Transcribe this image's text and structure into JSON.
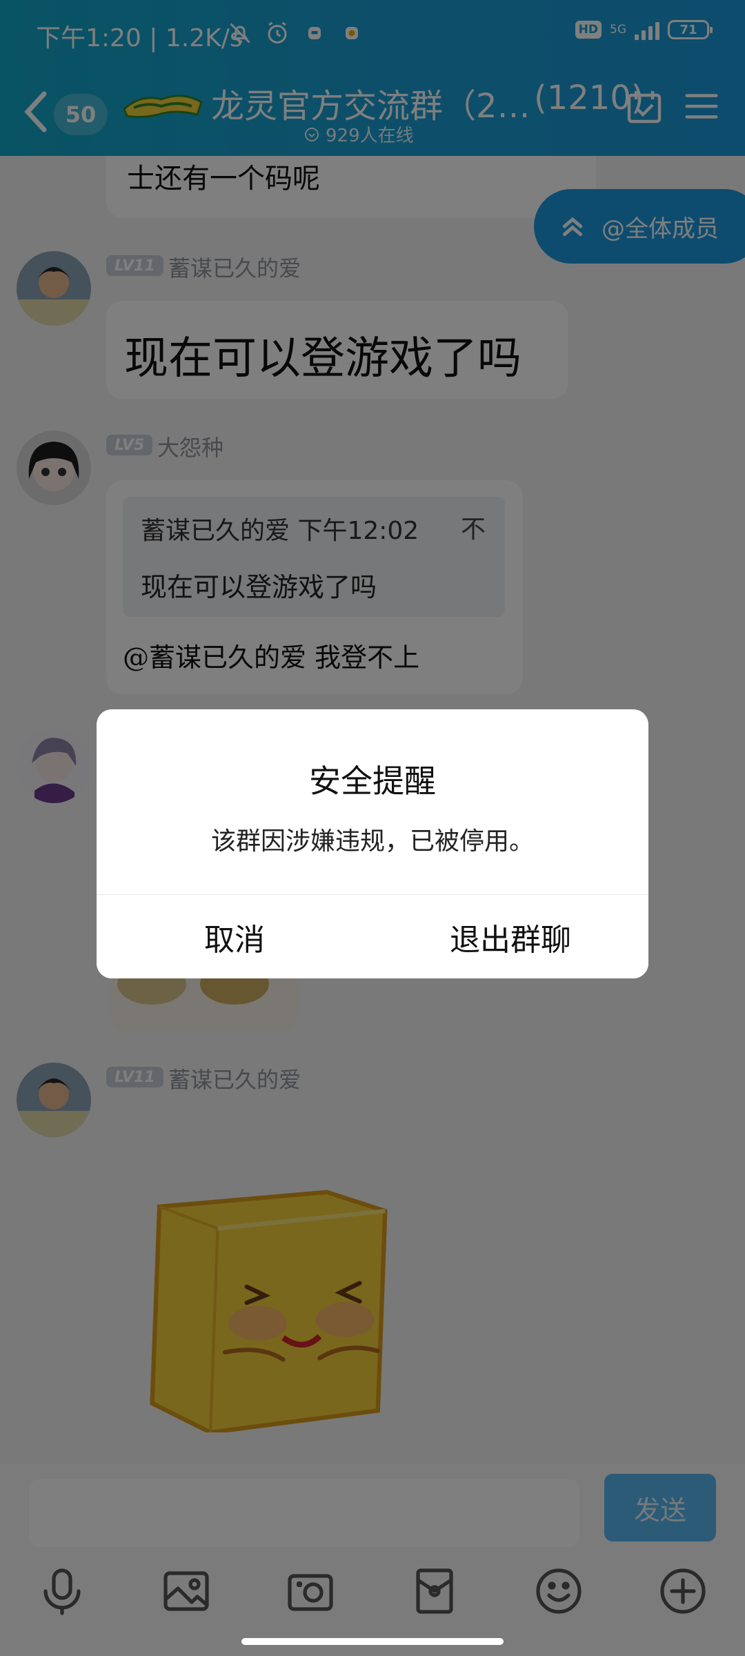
{
  "status_bar": {
    "time": "下午1:20 | 1.2K/s",
    "hd": "HD",
    "network": "5G",
    "battery": "71"
  },
  "header": {
    "unread_count": "50",
    "group_name": "龙灵官方交流群（2…",
    "member_count": "(1210)",
    "online_text": "929人在线"
  },
  "at_all_label": "@全体成员",
  "messages": [
    {
      "text": "士还有一个码呢"
    },
    {
      "level": "LV11",
      "nickname": "蓄谋已久的爱",
      "text": "现在可以登游戏了吗"
    },
    {
      "level": "LV5",
      "nickname": "大怨种",
      "quote": {
        "author_time": "蓄谋已久的爱 下午12:02",
        "close_glyph": "不",
        "text": "现在可以登游戏了吗"
      },
      "text": "@蓄谋已久的爱 我登不上"
    },
    {
      "type": "image"
    },
    {
      "level": "LV11",
      "nickname": "蓄谋已久的爱",
      "type": "sticker"
    }
  ],
  "input": {
    "placeholder": "",
    "send_label": "发送"
  },
  "toolbar_icons": [
    "microphone-icon",
    "image-icon",
    "camera-icon",
    "red-packet-icon",
    "emoji-icon",
    "plus-icon"
  ],
  "dialog": {
    "title": "安全提醒",
    "message": "该群因涉嫌违规，已被停用。",
    "cancel_label": "取消",
    "exit_label": "退出群聊"
  },
  "colors": {
    "header": "#1a9fd3",
    "accent": "#1c98df",
    "send_button": "#59b7f0"
  }
}
